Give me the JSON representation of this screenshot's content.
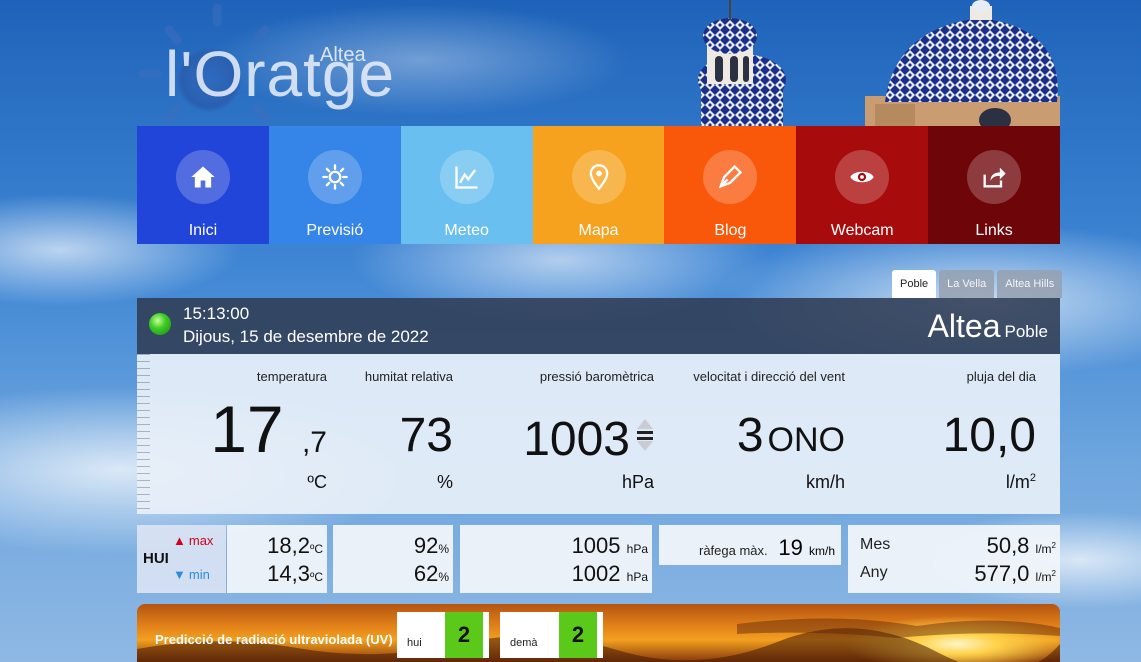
{
  "logo": {
    "name": "l'Oratge",
    "city": "Altea"
  },
  "nav": [
    {
      "label": "Inici",
      "icon": "home-icon",
      "color": "#2145d8"
    },
    {
      "label": "Previsió",
      "icon": "sun-icon",
      "color": "#3584e8"
    },
    {
      "label": "Meteo",
      "icon": "chart-icon",
      "color": "#69bff0"
    },
    {
      "label": "Mapa",
      "icon": "map-pin-icon",
      "color": "#f6a21e"
    },
    {
      "label": "Blog",
      "icon": "pen-icon",
      "color": "#f9580b"
    },
    {
      "label": "Webcam",
      "icon": "eye-icon",
      "color": "#a80b0b"
    },
    {
      "label": "Links",
      "icon": "share-icon",
      "color": "#6e0508"
    }
  ],
  "tabs": [
    "Poble",
    "La Vella",
    "Altea Hills"
  ],
  "status": {
    "time": "15:13:00",
    "date": "Dijous, 15 de desembre de 2022",
    "city": "Altea",
    "station": "Poble"
  },
  "current": {
    "temp_label": "temperatura",
    "temp_int": "17",
    "temp_dec": ",7",
    "temp_unit": "ºC",
    "hum_label": "humitat relativa",
    "hum_val": "73",
    "hum_unit": "%",
    "pres_label": "pressió baromètrica",
    "pres_val": "1003",
    "pres_unit": "hPa",
    "wind_label": "velocitat i direcció del vent",
    "wind_val": "3",
    "wind_dir": "ONO",
    "wind_unit": "km/h",
    "rain_label": "pluja del dia",
    "rain_val": "10,0",
    "rain_unit": "l/m"
  },
  "today": {
    "label": "HUI",
    "max_label": "max",
    "min_label": "min",
    "temp_max": "18,2",
    "temp_min": "14,3",
    "temp_unit": "ºC",
    "hum_max": "92",
    "hum_min": "62",
    "hum_unit": "%",
    "pres_max": "1005",
    "pres_min": "1002",
    "pres_unit": "hPa",
    "gust_label": "ràfega màx.",
    "gust_val": "19",
    "gust_unit": "km/h",
    "month_label": "Mes",
    "month_val": "50,8",
    "year_label": "Any",
    "year_val": "577,0",
    "rain_unit": "l/m"
  },
  "uv": {
    "title": "Predicció de radiació ultraviolada (UV)",
    "today_label": "hui",
    "today_val": "2",
    "tomorrow_label": "demà",
    "tomorrow_val": "2"
  }
}
